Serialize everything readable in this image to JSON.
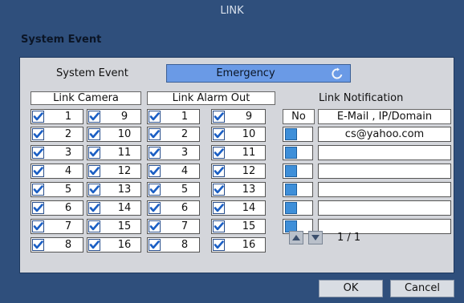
{
  "window": {
    "title": "LINK",
    "subtitle": "System Event"
  },
  "system_event": {
    "label": "System Event",
    "value": "Emergency",
    "icon": "refresh-icon"
  },
  "link_camera": {
    "header": "Link Camera",
    "col1": [
      "1",
      "2",
      "3",
      "4",
      "5",
      "6",
      "7",
      "8"
    ],
    "col2": [
      "9",
      "10",
      "11",
      "12",
      "13",
      "14",
      "15",
      "16"
    ]
  },
  "link_alarm": {
    "header": "Link Alarm Out",
    "col1": [
      "1",
      "2",
      "3",
      "4",
      "5",
      "6",
      "7",
      "8"
    ],
    "col2": [
      "9",
      "10",
      "11",
      "12",
      "13",
      "14",
      "15",
      "16"
    ]
  },
  "notification": {
    "header": "Link Notification",
    "col_no": "No",
    "col_email": "E-Mail , IP/Domain",
    "rows": [
      "cs@yahoo.com",
      "",
      "",
      "",
      "",
      ""
    ],
    "page": "1 / 1"
  },
  "buttons": {
    "ok": "OK",
    "cancel": "Cancel"
  },
  "colors": {
    "frame": "#2f4f7c",
    "panel": "#d4d6db",
    "accent": "#6a9ae6",
    "checkbox": "#3e8fd9"
  }
}
